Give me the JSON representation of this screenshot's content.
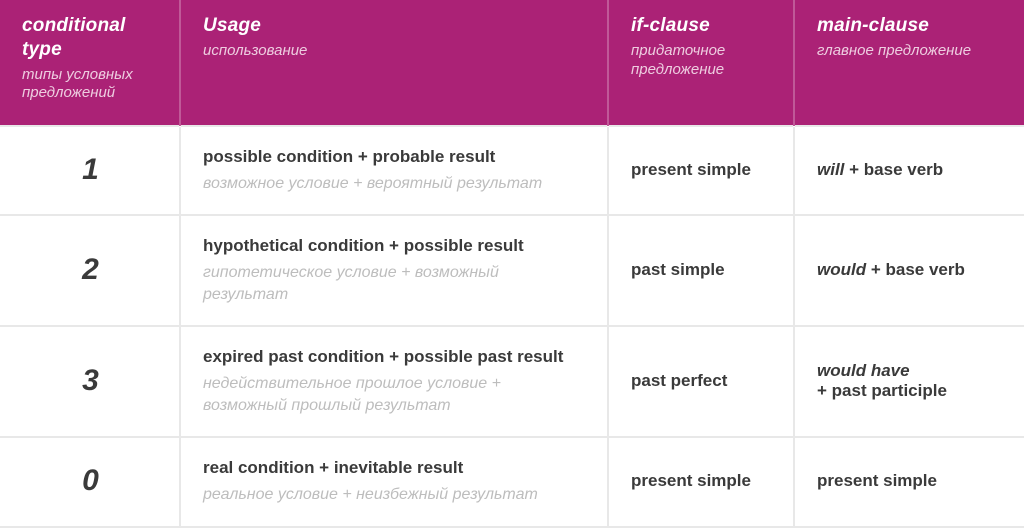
{
  "headers": [
    {
      "en": "conditional type",
      "ru": "типы условных предложений"
    },
    {
      "en": "Usage",
      "ru": "использование"
    },
    {
      "en": "if-clause",
      "ru": "придаточное предложение"
    },
    {
      "en": "main-clause",
      "ru": "главное предложение"
    }
  ],
  "rows": [
    {
      "type": "1",
      "usage_en": "possible condition + probable result",
      "usage_ru": "возможное условие + вероятный результат",
      "if": "present simple",
      "main_html": "<span class=\"bi\">will</span> + base verb"
    },
    {
      "type": "2",
      "usage_en": "hypothetical condition + possible result",
      "usage_ru": "гипотетическое условие + возможный результат",
      "if": "past simple",
      "main_html": "<span class=\"bi\">would</span> + base verb"
    },
    {
      "type": "3",
      "usage_en": "expired past condition + possible past result",
      "usage_ru": "недействительное прошлое условие + возможный прошлый результат",
      "if": "past perfect",
      "main_html": "<span class=\"bi\">would have</span><br>+ past participle"
    },
    {
      "type": "0",
      "usage_en": "real condition + inevitable result",
      "usage_ru": "реальное условие + неизбежный результат",
      "if": "present simple",
      "main_html": "present simple"
    }
  ]
}
